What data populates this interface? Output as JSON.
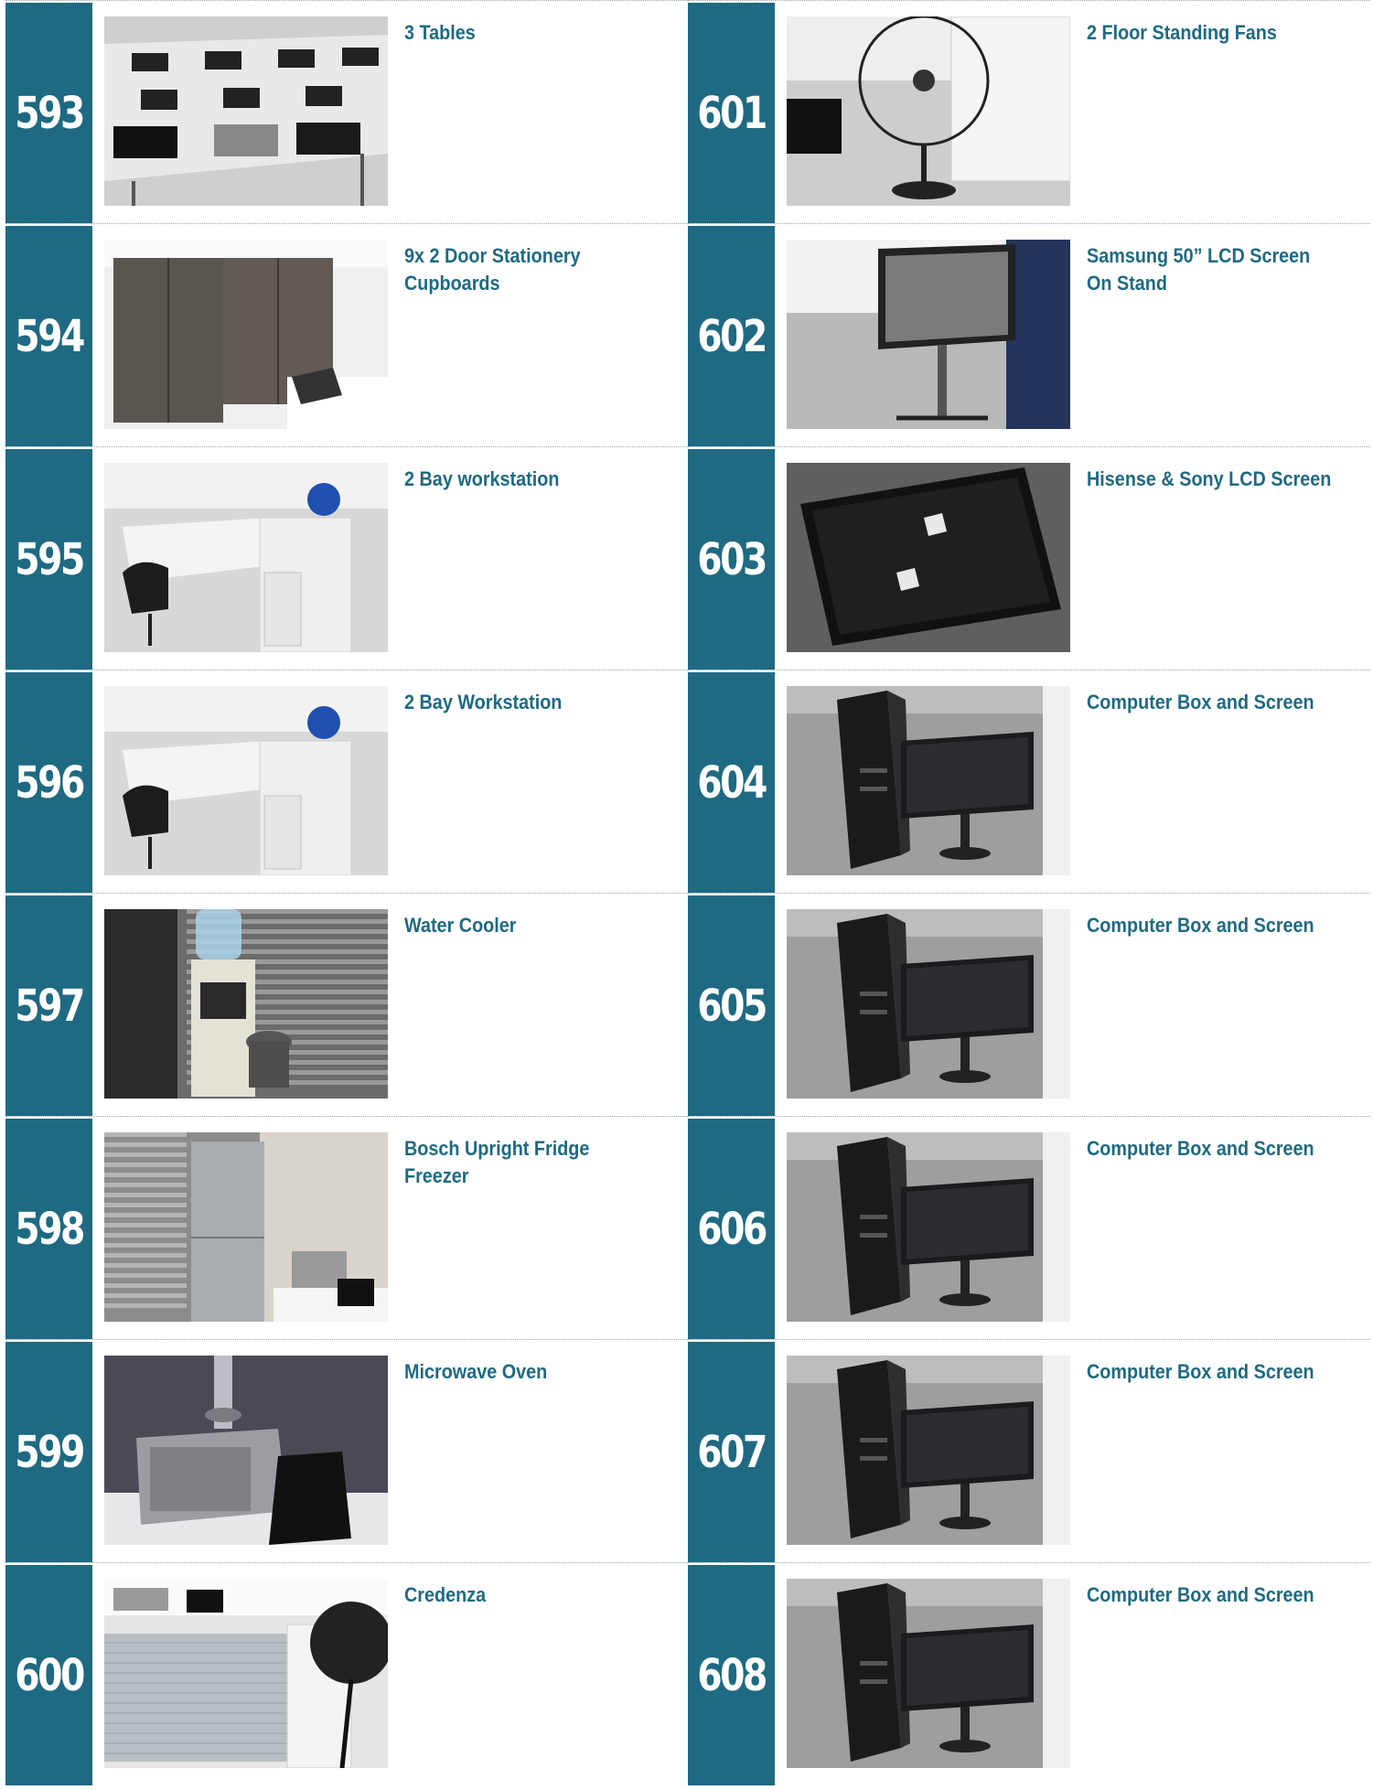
{
  "colors": {
    "accent": "#1e6a82",
    "divider": "#9aa3a8"
  },
  "left_column": [
    {
      "lot": "593",
      "title": "3 Tables",
      "photo": "tables-with-laptops-photo"
    },
    {
      "lot": "594",
      "title": "9x 2 Door Stationery Cupboards",
      "photo": "cupboards-photo"
    },
    {
      "lot": "595",
      "title": "2 Bay workstation",
      "photo": "workstation-photo"
    },
    {
      "lot": "596",
      "title": "2 Bay Workstation",
      "photo": "workstation-photo"
    },
    {
      "lot": "597",
      "title": "Water Cooler",
      "photo": "water-cooler-photo"
    },
    {
      "lot": "598",
      "title": "Bosch Upright Fridge Freezer",
      "photo": "fridge-freezer-photo"
    },
    {
      "lot": "599",
      "title": "Microwave Oven",
      "photo": "microwave-photo"
    },
    {
      "lot": "600",
      "title": "Credenza",
      "photo": "credenza-photo"
    }
  ],
  "right_column": [
    {
      "lot": "601",
      "title": "2 Floor Standing Fans",
      "photo": "floor-fan-photo"
    },
    {
      "lot": "602",
      "title": "Samsung 50” LCD Screen On Stand",
      "photo": "lcd-on-stand-photo"
    },
    {
      "lot": "603",
      "title": "Hisense & Sony  LCD Screen",
      "photo": "lcd-screen-photo"
    },
    {
      "lot": "604",
      "title": "Computer Box and Screen",
      "photo": "computer-and-screen-photo"
    },
    {
      "lot": "605",
      "title": "Computer Box and Screen",
      "photo": "computer-and-screen-photo"
    },
    {
      "lot": "606",
      "title": "Computer Box and Screen",
      "photo": "computer-and-screen-photo"
    },
    {
      "lot": "607",
      "title": "Computer Box and Screen",
      "photo": "computer-and-screen-photo"
    },
    {
      "lot": "608",
      "title": "Computer Box and Screen",
      "photo": "computer-and-screen-photo"
    }
  ]
}
